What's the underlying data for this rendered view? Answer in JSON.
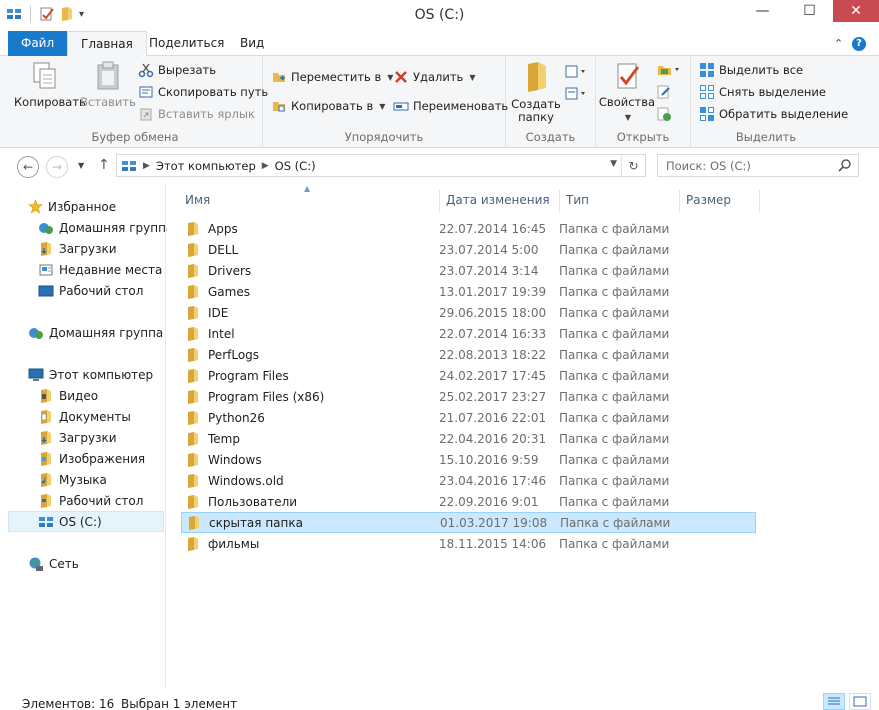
{
  "window": {
    "title": "OS (C:)",
    "minimize": "—",
    "maximize": "☐",
    "close": "✕"
  },
  "qat": {
    "dropdown": "▾"
  },
  "tabs": [
    {
      "label": "Файл"
    },
    {
      "label": "Главная"
    },
    {
      "label": "Поделиться"
    },
    {
      "label": "Вид"
    }
  ],
  "ribbon_controls": {
    "collapse": "⌃",
    "help": "?"
  },
  "ribbon": {
    "clipboard": {
      "label": "Буфер обмена",
      "copy": "Копировать",
      "paste": "Вставить",
      "cut": "Вырезать",
      "copy_path": "Скопировать путь",
      "paste_shortcut": "Вставить ярлык"
    },
    "organize": {
      "label": "Упорядочить",
      "move_to": "Переместить в",
      "copy_to": "Копировать в",
      "delete": "Удалить",
      "rename": "Переименовать"
    },
    "create": {
      "label": "Создать",
      "new_folder_line1": "Создать",
      "new_folder_line2": "папку"
    },
    "open": {
      "label": "Открыть",
      "properties": "Свойства"
    },
    "select": {
      "label": "Выделить",
      "select_all": "Выделить все",
      "select_none": "Снять выделение",
      "invert": "Обратить выделение"
    }
  },
  "address": {
    "crumbs": [
      "Этот компьютер",
      "OS (C:)"
    ],
    "search_placeholder": "Поиск: OS (C:)"
  },
  "sidebar": {
    "favorites": "Избранное",
    "favorites_items": [
      "Домашняя группа",
      "Загрузки",
      "Недавние места",
      "Рабочий стол"
    ],
    "homegroup": "Домашняя группа",
    "computer": "Этот компьютер",
    "computer_items": [
      "Видео",
      "Документы",
      "Загрузки",
      "Изображения",
      "Музыка",
      "Рабочий стол",
      "OS (C:)"
    ],
    "network": "Сеть"
  },
  "columns": {
    "name": "Имя",
    "date": "Дата изменения",
    "type": "Тип",
    "size": "Размер"
  },
  "files": [
    {
      "name": "Apps",
      "date": "22.07.2014 16:45",
      "type": "Папка с файлами"
    },
    {
      "name": "DELL",
      "date": "23.07.2014 5:00",
      "type": "Папка с файлами"
    },
    {
      "name": "Drivers",
      "date": "23.07.2014 3:14",
      "type": "Папка с файлами"
    },
    {
      "name": "Games",
      "date": "13.01.2017 19:39",
      "type": "Папка с файлами"
    },
    {
      "name": "IDE",
      "date": "29.06.2015 18:00",
      "type": "Папка с файлами"
    },
    {
      "name": "Intel",
      "date": "22.07.2014 16:33",
      "type": "Папка с файлами"
    },
    {
      "name": "PerfLogs",
      "date": "22.08.2013 18:22",
      "type": "Папка с файлами"
    },
    {
      "name": "Program Files",
      "date": "24.02.2017 17:45",
      "type": "Папка с файлами"
    },
    {
      "name": "Program Files (x86)",
      "date": "25.02.2017 23:27",
      "type": "Папка с файлами"
    },
    {
      "name": "Python26",
      "date": "21.07.2016 22:01",
      "type": "Папка с файлами"
    },
    {
      "name": "Temp",
      "date": "22.04.2016 20:31",
      "type": "Папка с файлами"
    },
    {
      "name": "Windows",
      "date": "15.10.2016 9:59",
      "type": "Папка с файлами"
    },
    {
      "name": "Windows.old",
      "date": "23.04.2016 17:46",
      "type": "Папка с файлами"
    },
    {
      "name": "Пользователи",
      "date": "22.09.2016 9:01",
      "type": "Папка с файлами"
    },
    {
      "name": "скрытая папка",
      "date": "01.03.2017 19:08",
      "type": "Папка с файлами",
      "selected": true
    },
    {
      "name": "фильмы",
      "date": "18.11.2015 14:06",
      "type": "Папка с файлами"
    }
  ],
  "status": {
    "count": "Элементов: 16",
    "selected": "Выбран 1 элемент"
  },
  "colors": {
    "accent": "#1979ca",
    "folder": "#e8b84a",
    "selection": "#cce8ff"
  }
}
